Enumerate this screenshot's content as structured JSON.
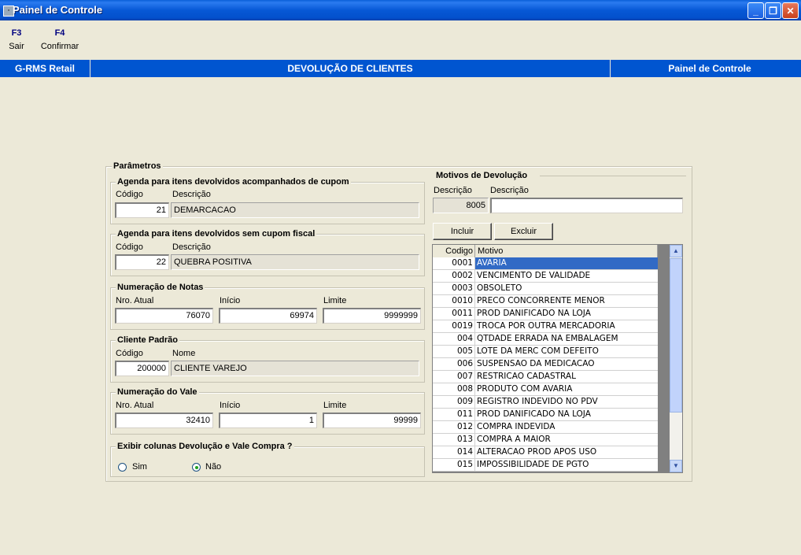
{
  "window": {
    "title": "Painel de Controle",
    "icon": "app-icon"
  },
  "toolbar": [
    {
      "key": "F3",
      "label": "Sair"
    },
    {
      "key": "F4",
      "label": "Confirmar"
    }
  ],
  "header": {
    "left": "G-RMS Retail",
    "center": "DEVOLUÇÃO DE CLIENTES",
    "right": "Painel de Controle"
  },
  "parametros": {
    "title": "Parâmetros",
    "agenda_cupom": {
      "title": "Agenda para itens devolvidos acompanhados de cupom",
      "codigo_label": "Código",
      "descricao_label": "Descrição",
      "codigo": "21",
      "descricao": "DEMARCACAO"
    },
    "agenda_sem_cupom": {
      "title": "Agenda para itens devolvidos sem cupom fiscal",
      "codigo_label": "Código",
      "descricao_label": "Descrição",
      "codigo": "22",
      "descricao": "QUEBRA POSITIVA"
    },
    "numeracao_notas": {
      "title": "Numeração de Notas",
      "atual_label": "Nro. Atual",
      "inicio_label": "Início",
      "limite_label": "Limite",
      "atual": "76070",
      "inicio": "69974",
      "limite": "9999999"
    },
    "cliente_padrao": {
      "title": "Cliente Padrão",
      "codigo_label": "Código",
      "nome_label": "Nome",
      "codigo": "200000",
      "nome": "CLIENTE VAREJO"
    },
    "numeracao_vale": {
      "title": "Numeração do Vale",
      "atual_label": "Nro. Atual",
      "inicio_label": "Início",
      "limite_label": "Limite",
      "atual": "32410",
      "inicio": "1",
      "limite": "99999"
    },
    "exibir_colunas": {
      "title": "Exibir colunas Devolução e Vale Compra ?",
      "sim": "Sim",
      "nao": "Não",
      "selected": "Não"
    }
  },
  "motivos": {
    "title": "Motivos de Devolução",
    "descricao_label_1": "Descrição",
    "descricao_label_2": "Descrição",
    "codigo_value": "8005",
    "descricao_value": "",
    "incluir": "Incluir",
    "excluir": "Excluir",
    "columns": [
      "Codigo",
      "Motivo"
    ],
    "rows": [
      [
        "0001",
        "AVARIA"
      ],
      [
        "0002",
        "VENCIMENTO DE VALIDADE"
      ],
      [
        "0003",
        "OBSOLETO"
      ],
      [
        "0010",
        "PRECO CONCORRENTE MENOR"
      ],
      [
        "0011",
        "PROD DANIFICADO NA LOJA"
      ],
      [
        "0019",
        "TROCA  POR  OUTRA  MERCADORIA"
      ],
      [
        "004",
        "QTDADE ERRADA NA EMBALAGEM"
      ],
      [
        "005",
        "LOTE DA MERC COM DEFEITO"
      ],
      [
        "006",
        "SUSPENSAO DA MEDICACAO"
      ],
      [
        "007",
        "RESTRICAO CADASTRAL"
      ],
      [
        "008",
        "PRODUTO COM AVARIA"
      ],
      [
        "009",
        "REGISTRO INDEVIDO NO PDV"
      ],
      [
        "011",
        "PROD DANIFICADO NA LOJA"
      ],
      [
        "012",
        "COMPRA INDEVIDA"
      ],
      [
        "013",
        "COMPRA A MAIOR"
      ],
      [
        "014",
        "ALTERACAO PROD APOS USO"
      ],
      [
        "015",
        "IMPOSSIBILIDADE DE PGTO"
      ]
    ],
    "selected_row": 0
  }
}
